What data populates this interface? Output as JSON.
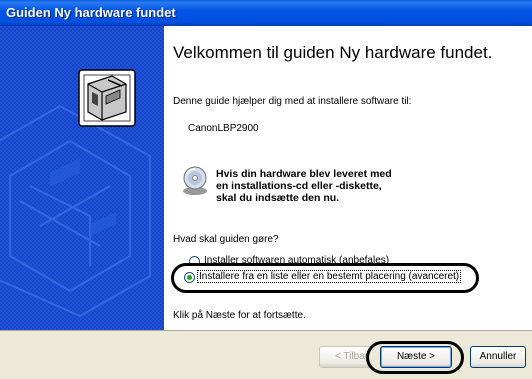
{
  "window": {
    "title": "Guiden Ny hardware fundet"
  },
  "heading": "Velkommen til guiden Ny hardware fundet.",
  "intro": "Denne guide hjælper dig med at installere software til:",
  "device": "CanonLBP2900",
  "cd_notice": {
    "line1": "Hvis din hardware blev leveret med",
    "line2": "en installations-cd eller -diskette,",
    "line3": "skal du indsætte den nu.",
    "icon": "cd-install-icon"
  },
  "question": "Hvad skal guiden gøre?",
  "options": [
    {
      "label": "Installer softwaren automatisk (anbefales)",
      "selected": false
    },
    {
      "label": "Installere fra en liste eller en bestemt placering (avanceret)",
      "selected": true
    }
  ],
  "continue_hint": "Klik på Næste for at fortsætte.",
  "buttons": {
    "back": "< Tilbage",
    "next": "Næste >",
    "cancel": "Annuller"
  },
  "colors": {
    "titlebar": "#0055e5",
    "sidebar": "#1747c8",
    "highlight_ring": "#000000",
    "radio_dot": "#2ca01c"
  }
}
